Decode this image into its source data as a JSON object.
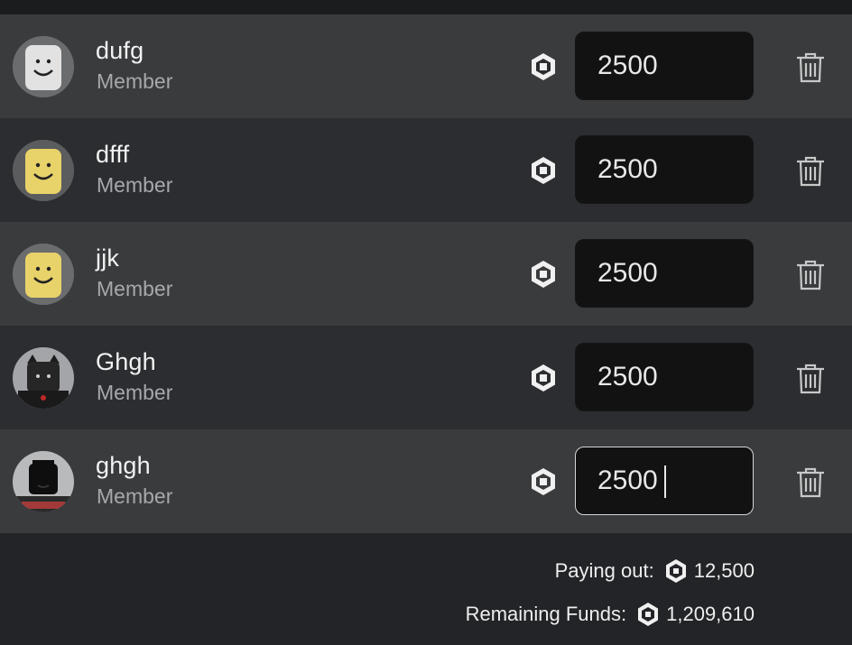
{
  "members": [
    {
      "name": "dufg",
      "role": "Member",
      "amount": "2500",
      "avatar": "smile-face-gray"
    },
    {
      "name": "dfff",
      "role": "Member",
      "amount": "2500",
      "avatar": "smile-face-yellow"
    },
    {
      "name": "jjk",
      "role": "Member",
      "amount": "2500",
      "avatar": "smile-face-yellow"
    },
    {
      "name": "Ghgh",
      "role": "Member",
      "amount": "2500",
      "avatar": "custom-character-dark"
    },
    {
      "name": "ghgh",
      "role": "Member",
      "amount": "2500",
      "avatar": "custom-character-black"
    }
  ],
  "summary": {
    "paying_label": "Paying out:",
    "paying_value": "12,500",
    "remaining_label": "Remaining Funds:",
    "remaining_value": "1,209,610"
  },
  "icons": {
    "currency": "robux-icon",
    "delete": "trash-icon"
  },
  "colors": {
    "row_light": "#393b3d",
    "row_dark": "#2b2d30",
    "input_bg": "#121213",
    "focus_border": "#d6d6d6"
  }
}
